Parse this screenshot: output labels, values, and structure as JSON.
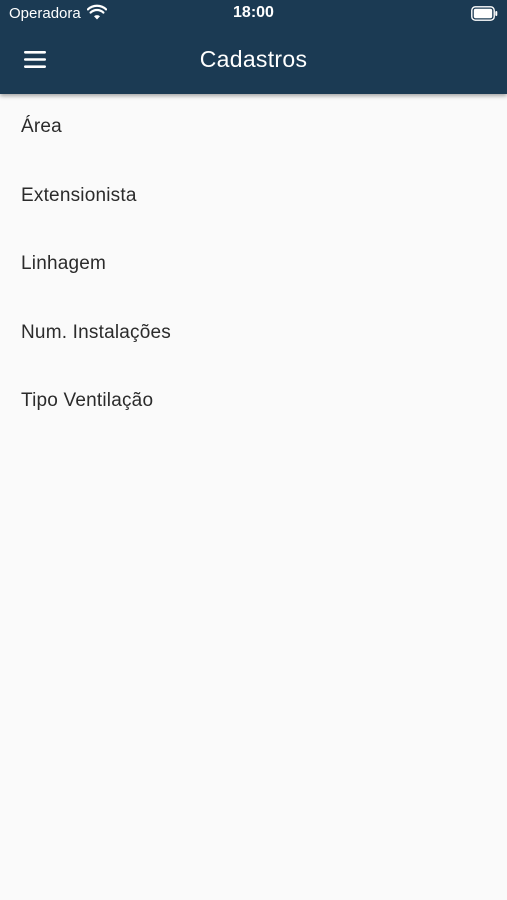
{
  "status_bar": {
    "carrier": "Operadora",
    "time": "18:00",
    "wifi_icon": "wifi-icon",
    "battery_icon": "battery-full-icon"
  },
  "app_bar": {
    "title": "Cadastros",
    "menu_icon": "hamburger-menu-icon",
    "background": "#1b3a53"
  },
  "menu_items": [
    {
      "label": "Área"
    },
    {
      "label": "Extensionista"
    },
    {
      "label": "Linhagem"
    },
    {
      "label": "Num. Instalações"
    },
    {
      "label": "Tipo Ventilação"
    }
  ]
}
